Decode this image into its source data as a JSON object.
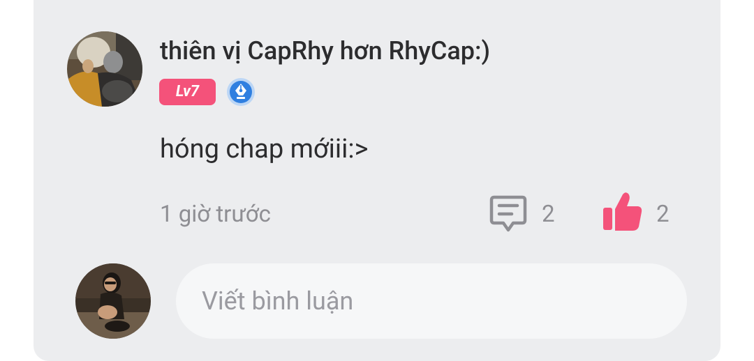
{
  "comment": {
    "author": {
      "name": "thiên vị CapRhy hơn RhyCap:)",
      "level": "Lv7",
      "avatar_icon": "user-avatar-photo",
      "badge_icon": "pen-nib-badge-icon"
    },
    "text": "hóng chap mớiii:>",
    "time": "1 giờ trước",
    "reply_count": "2",
    "like_count": "2",
    "reply_icon": "comment-bubble-icon",
    "like_icon": "thumbs-up-icon"
  },
  "composer": {
    "placeholder": "Viết bình luận",
    "avatar_icon": "current-user-avatar-photo"
  },
  "colors": {
    "card_bg": "#ecedef",
    "input_bg": "#f6f7f8",
    "accent": "#f4527a",
    "badge_blue": "#2f7fe0",
    "text_primary": "#2c2c2e",
    "text_secondary": "#8e8e93"
  }
}
